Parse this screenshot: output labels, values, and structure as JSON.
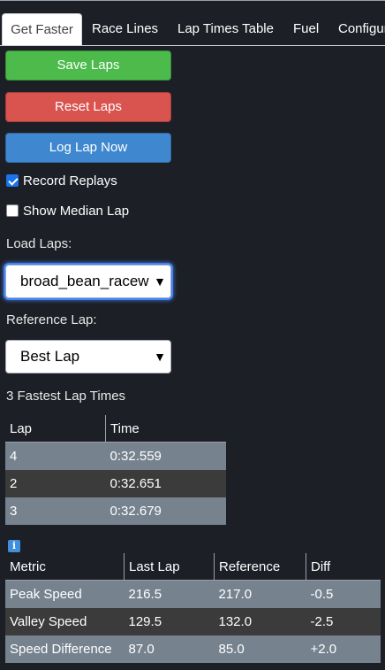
{
  "tabs": [
    {
      "label": "Get Faster",
      "active": true
    },
    {
      "label": "Race Lines"
    },
    {
      "label": "Lap Times Table"
    },
    {
      "label": "Fuel"
    },
    {
      "label": "Configure"
    }
  ],
  "buttons": {
    "save": "Save Laps",
    "reset": "Reset Laps",
    "log": "Log Lap Now"
  },
  "checkboxes": {
    "record_replays": {
      "label": "Record Replays",
      "checked": true
    },
    "show_median": {
      "label": "Show Median Lap",
      "checked": false
    }
  },
  "load_laps": {
    "label": "Load Laps:",
    "value": "broad_bean_raceway"
  },
  "reference_lap": {
    "label": "Reference Lap:",
    "value": "Best Lap"
  },
  "fastest": {
    "title": "3 Fastest Lap Times",
    "headers": [
      "Lap",
      "Time"
    ],
    "rows": [
      [
        "4",
        "0:32.559"
      ],
      [
        "2",
        "0:32.651"
      ],
      [
        "3",
        "0:32.679"
      ]
    ]
  },
  "info_icon": "info-icon",
  "metrics": {
    "headers": [
      "Metric",
      "Last Lap",
      "Reference",
      "Diff"
    ],
    "rows": [
      [
        "Peak Speed",
        "216.5",
        "217.0",
        "-0.5"
      ],
      [
        "Valley Speed",
        "129.5",
        "132.0",
        "-2.5"
      ],
      [
        "Speed Difference",
        "87.0",
        "85.0",
        "+2.0"
      ]
    ]
  },
  "colors": {
    "save": "#4cbb4c",
    "reset": "#d9534f",
    "log": "#3f88d0",
    "background": "#1c1f26"
  }
}
